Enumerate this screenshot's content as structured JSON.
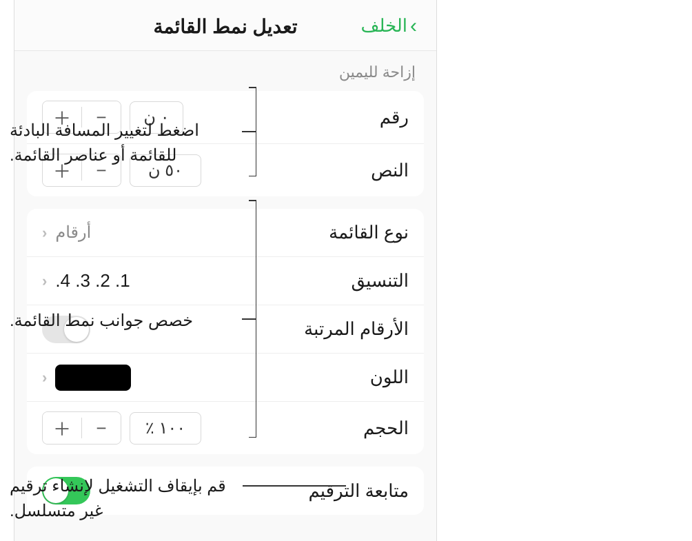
{
  "header": {
    "back_label": "الخلف",
    "title": "تعديل نمط القائمة"
  },
  "indent_section": {
    "header": "إزاحة لليمين",
    "number_row": {
      "label": "رقم",
      "value": "٠ ن"
    },
    "text_row": {
      "label": "النص",
      "value": "٥٠ ن"
    }
  },
  "style_section": {
    "list_type": {
      "label": "نوع القائمة",
      "value": "أرقام"
    },
    "format": {
      "label": "التنسيق",
      "value": ".4 .3 .2 .1"
    },
    "tiered": {
      "label": "الأرقام المرتبة",
      "enabled": false
    },
    "color": {
      "label": "اللون",
      "value_hex": "#000000"
    },
    "size": {
      "label": "الحجم",
      "value": "١٠٠ ٪"
    }
  },
  "continue_section": {
    "label": "متابعة الترقيم",
    "enabled": true
  },
  "callouts": {
    "indent": "اضغط لتغيير المسافة البادئة للقائمة أو عناصر القائمة.",
    "customize": "خصص جوانب نمط القائمة.",
    "continue": "قم بإيقاف التشغيل لإنشاء ترقيم غير متسلسل."
  },
  "icons": {
    "plus": "＋",
    "minus": "−",
    "chevron_right": "›",
    "chevron_left": "‹"
  }
}
